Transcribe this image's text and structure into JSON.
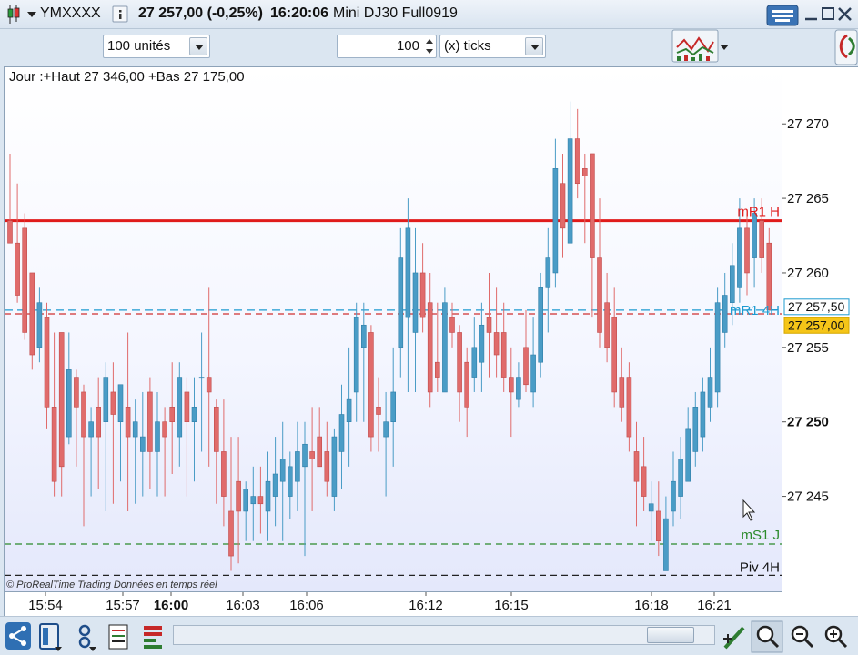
{
  "titlebar": {
    "symbol": "YMXXXX",
    "info_icon": "info-icon",
    "price_change": "27 257,00 (-0,25%)",
    "time": "16:20:06",
    "instrument": "Mini DJ30 Full0919"
  },
  "toolbar": {
    "units": "100 unités",
    "ticks_value": "100",
    "ticks_unit": "(x) ticks"
  },
  "chart_info": "Jour :+Haut 27 346,00 +Bas 27 175,00",
  "copyright": "© ProRealTime Trading  Données en temps réel",
  "colors": {
    "up": "#4a9cc6",
    "down": "#e06b6b",
    "resistance": "#e01b1b",
    "pivot_4h": "#1e9bd0",
    "support": "#2b8a2b",
    "price_label_bg": "#f5c518"
  },
  "chart_data": {
    "type": "candlestick",
    "ylim": [
      27238.5,
      27273.8
    ],
    "y_ticks": [
      "27 270",
      "27 265",
      "27 260",
      "27 255",
      "27 250",
      "27 245"
    ],
    "y_tick_values": [
      27270,
      27265,
      27260,
      27255,
      27250,
      27245
    ],
    "highlighted_tick": "27 250",
    "x_ticks": [
      "15:54",
      "15:57",
      "16:00",
      "16:03",
      "16:06",
      "16:12",
      "16:15",
      "16:18",
      "16:21"
    ],
    "highlighted_x_tick": "16:00",
    "price_labels": {
      "price_a": "27 257,50",
      "price_b": "27 257,00"
    },
    "levels": [
      {
        "name": "mR1 H",
        "value": 27263.5,
        "style": "solid",
        "color": "#e01b1b"
      },
      {
        "name": "mR1 4H",
        "value": 27257.5,
        "style": "dashed",
        "color": "#1e9bd0"
      },
      {
        "name": "",
        "value": 27257.25,
        "style": "dashed",
        "color": "#d03030"
      },
      {
        "name": "mS1 J",
        "value": 27241.8,
        "style": "dashed",
        "color": "#2b8a2b"
      },
      {
        "name": "Piv 4H",
        "value": 27239.7,
        "style": "dashed",
        "color": "#222222"
      }
    ],
    "candles": [
      [
        27263.5,
        27268.0,
        27262.0,
        27262.0
      ],
      [
        27262.0,
        27266.0,
        27258.0,
        27258.5
      ],
      [
        27263.0,
        27264.0,
        27255.5,
        27256.0
      ],
      [
        27260.0,
        27260.0,
        27253.5,
        27254.5
      ],
      [
        27255.0,
        27259.0,
        27254.0,
        27258.0
      ],
      [
        27257.0,
        27258.0,
        27249.5,
        27251.0
      ],
      [
        27251.0,
        27256.0,
        27245.0,
        27246.0
      ],
      [
        27256.0,
        27256.0,
        27245.0,
        27247.0
      ],
      [
        27249.0,
        27256.0,
        27248.5,
        27253.5
      ],
      [
        27253.0,
        27253.5,
        27247.0,
        27251.0
      ],
      [
        27252.0,
        27252.5,
        27243.0,
        27249.0
      ],
      [
        27249.0,
        27251.0,
        27245.0,
        27250.0
      ],
      [
        27251.0,
        27253.0,
        27245.5,
        27249.0
      ],
      [
        27250.0,
        27254.0,
        27244.0,
        27253.0
      ],
      [
        27252.0,
        27254.0,
        27244.5,
        27250.5
      ],
      [
        27250.0,
        27252.0,
        27246.0,
        27252.5
      ],
      [
        27251.0,
        27256.0,
        27244.0,
        27249.0
      ],
      [
        27249.0,
        27251.5,
        27244.5,
        27250.0
      ],
      [
        27248.0,
        27252.0,
        27245.0,
        27249.0
      ],
      [
        27252.0,
        27253.0,
        27245.5,
        27248.0
      ],
      [
        27248.0,
        27252.0,
        27245.0,
        27250.0
      ],
      [
        27250.0,
        27251.0,
        27245.0,
        27249.0
      ],
      [
        27251.0,
        27254.0,
        27246.5,
        27250.0
      ],
      [
        27249.0,
        27254.0,
        27247.0,
        27253.0
      ],
      [
        27252.0,
        27253.0,
        27245.0,
        27250.0
      ],
      [
        27250.0,
        27253.0,
        27246.0,
        27251.0
      ],
      [
        27253.0,
        27256.0,
        27248.0,
        27253.0
      ],
      [
        27253.0,
        27259.0,
        27247.0,
        27252.0
      ],
      [
        27251.0,
        27251.5,
        27244.5,
        27248.0
      ],
      [
        27248.0,
        27251.5,
        27243.0,
        27245.0
      ],
      [
        27244.0,
        27249.0,
        27240.0,
        27241.0
      ],
      [
        27246.0,
        27249.0,
        27240.5,
        27244.0
      ],
      [
        27244.0,
        27246.0,
        27242.0,
        27245.5
      ],
      [
        27244.5,
        27247.0,
        27242.0,
        27245.0
      ],
      [
        27245.0,
        27247.0,
        27242.5,
        27244.5
      ],
      [
        27244.0,
        27248.0,
        27242.0,
        27246.0
      ],
      [
        27245.0,
        27249.0,
        27243.0,
        27246.5
      ],
      [
        27246.0,
        27250.0,
        27242.0,
        27247.5
      ],
      [
        27245.0,
        27248.0,
        27243.5,
        27247.0
      ],
      [
        27246.0,
        27250.0,
        27244.0,
        27248.0
      ],
      [
        27247.0,
        27250.0,
        27241.0,
        27248.5
      ],
      [
        27248.0,
        27251.0,
        27244.0,
        27247.5
      ],
      [
        27249.0,
        27251.0,
        27247.0,
        27247.0
      ],
      [
        27248.0,
        27250.0,
        27245.0,
        27246.0
      ],
      [
        27245.0,
        27249.5,
        27244.0,
        27249.0
      ],
      [
        27248.0,
        27252.5,
        27245.5,
        27250.5
      ],
      [
        27250.0,
        27255.0,
        27247.0,
        27251.5
      ],
      [
        27252.0,
        27258.0,
        27250.0,
        27257.0
      ],
      [
        27255.0,
        27258.0,
        27250.0,
        27256.5
      ],
      [
        27256.0,
        27256.5,
        27248.0,
        27249.0
      ],
      [
        27251.0,
        27253.0,
        27248.0,
        27250.5
      ],
      [
        27249.0,
        27252.0,
        27245.0,
        27250.0
      ],
      [
        27250.0,
        27255.0,
        27247.0,
        27252.0
      ],
      [
        27255.0,
        27263.0,
        27253.0,
        27261.0
      ],
      [
        27257.0,
        27265.0,
        27252.0,
        27263.0
      ],
      [
        27256.0,
        27263.0,
        27252.0,
        27260.0
      ],
      [
        27260.0,
        27262.0,
        27256.0,
        27257.0
      ],
      [
        27258.0,
        27260.0,
        27251.0,
        27252.0
      ],
      [
        27254.0,
        27258.0,
        27252.0,
        27253.0
      ],
      [
        27252.0,
        27259.0,
        27253.0,
        27258.0
      ],
      [
        27257.0,
        27258.0,
        27255.0,
        27256.0
      ],
      [
        27256.0,
        27256.5,
        27250.0,
        27252.0
      ],
      [
        27254.0,
        27255.0,
        27249.0,
        27251.0
      ],
      [
        27253.0,
        27257.0,
        27252.0,
        27255.0
      ],
      [
        27254.0,
        27258.0,
        27252.0,
        27256.5
      ],
      [
        27257.0,
        27260.0,
        27253.0,
        27256.0
      ],
      [
        27256.0,
        27259.0,
        27253.0,
        27254.5
      ],
      [
        27256.0,
        27258.0,
        27252.0,
        27253.0
      ],
      [
        27253.0,
        27255.0,
        27249.0,
        27252.0
      ],
      [
        27251.5,
        27254.0,
        27251.0,
        27253.0
      ],
      [
        27255.0,
        27257.5,
        27252.0,
        27252.5
      ],
      [
        27252.0,
        27257.0,
        27251.0,
        27254.5
      ],
      [
        27254.0,
        27260.0,
        27253.0,
        27259.0
      ],
      [
        27259.0,
        27263.0,
        27256.0,
        27261.0
      ],
      [
        27260.0,
        27269.0,
        27259.0,
        27267.0
      ],
      [
        27266.0,
        27268.0,
        27261.0,
        27263.0
      ],
      [
        27262.0,
        27271.5,
        27262.0,
        27269.0
      ],
      [
        27269.0,
        27271.0,
        27265.0,
        27266.0
      ],
      [
        27267.0,
        27268.0,
        27262.0,
        27266.5
      ],
      [
        27268.0,
        27268.0,
        27257.0,
        27261.0
      ],
      [
        27261.0,
        27265.0,
        27255.0,
        27256.0
      ],
      [
        27258.0,
        27260.0,
        27254.0,
        27255.0
      ],
      [
        27257.0,
        27259.0,
        27251.0,
        27252.0
      ],
      [
        27253.0,
        27255.0,
        27250.0,
        27251.0
      ],
      [
        27253.0,
        27254.0,
        27248.0,
        27249.0
      ],
      [
        27248.0,
        27250.0,
        27243.0,
        27246.0
      ],
      [
        27247.0,
        27249.0,
        27244.0,
        27245.0
      ],
      [
        27244.0,
        27246.0,
        27242.0,
        27244.5
      ],
      [
        27244.0,
        27246.0,
        27241.0,
        27242.0
      ],
      [
        27240.0,
        27245.0,
        27241.5,
        27243.5
      ],
      [
        27244.0,
        27248.0,
        27243.0,
        27246.0
      ],
      [
        27245.0,
        27249.0,
        27243.5,
        27247.5
      ],
      [
        27246.0,
        27251.0,
        27246.0,
        27249.5
      ],
      [
        27248.0,
        27252.0,
        27247.0,
        27251.0
      ],
      [
        27249.0,
        27253.0,
        27248.0,
        27252.0
      ],
      [
        27251.0,
        27255.0,
        27250.0,
        27253.0
      ],
      [
        27252.0,
        27259.0,
        27251.0,
        27258.0
      ],
      [
        27256.0,
        27260.0,
        27255.0,
        27258.5
      ],
      [
        27258.0,
        27262.0,
        27256.5,
        27260.5
      ],
      [
        27259.0,
        27265.0,
        27258.0,
        27263.0
      ],
      [
        27263.0,
        27264.0,
        27258.5,
        27260.0
      ],
      [
        27261.0,
        27265.0,
        27259.0,
        27264.0
      ],
      [
        27263.5,
        27265.0,
        27260.0,
        27261.0
      ],
      [
        27262.0,
        27263.0,
        27257.5,
        27257.5
      ]
    ]
  }
}
